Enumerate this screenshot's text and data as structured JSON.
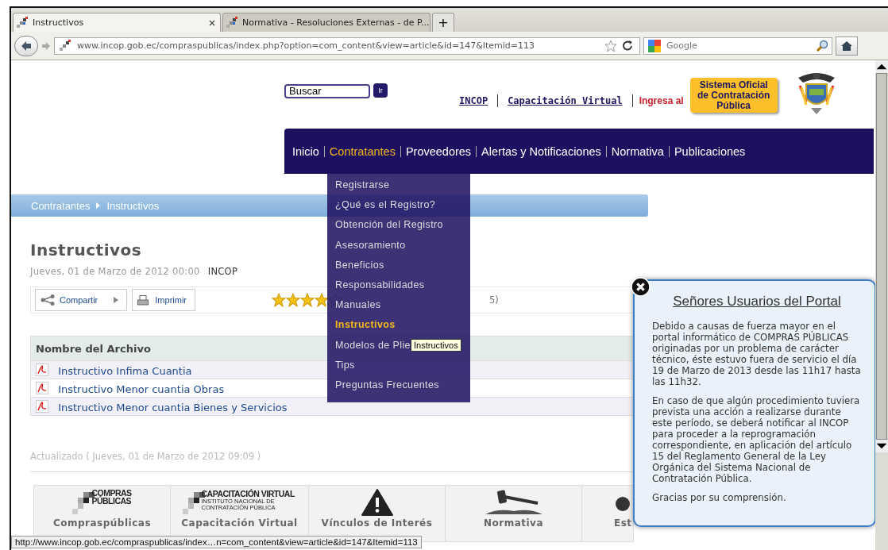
{
  "browser": {
    "tabs": [
      {
        "label": "Instructivos",
        "selected": true
      },
      {
        "label": "Normativa - Resoluciones Externas - de P...",
        "selected": false
      }
    ],
    "new_tab": "+",
    "address": "www.incop.gob.ec/compraspublicas/index.php?option=com_content&view=article&id=147&Itemid=113",
    "search_placeholder": "Google"
  },
  "header": {
    "search": {
      "value": "Buscar"
    },
    "search_button": "Ir",
    "links": [
      "INCOP",
      "Capacitación Virtual"
    ],
    "promo_label": "Ingresa al",
    "promo_button": "Sistema Oficial de Contratación Pública"
  },
  "nav": [
    {
      "label": "Inicio",
      "selected": false
    },
    {
      "label": "Contratantes",
      "selected": true
    },
    {
      "label": "Proveedores",
      "selected": false
    },
    {
      "label": "Alertas y Notificaciones",
      "selected": false
    },
    {
      "label": "Normativa",
      "selected": false
    },
    {
      "label": "Publicaciones",
      "selected": false
    }
  ],
  "dropdown": [
    {
      "label": "Registrarse",
      "selected": false
    },
    {
      "label": "¿Qué es el Registro?",
      "selected": false
    },
    {
      "label": "Obtención del Registro",
      "selected": false
    },
    {
      "label": "Asesoramiento",
      "selected": false
    },
    {
      "label": "Beneficios",
      "selected": false
    },
    {
      "label": "Responsabilidades",
      "selected": false
    },
    {
      "label": "Manuales",
      "selected": false
    },
    {
      "label": "Instructivos",
      "selected": true
    },
    {
      "label": "Modelos de Plie",
      "selected": false
    },
    {
      "label": "Tips",
      "selected": false
    },
    {
      "label": "Preguntas Frecuentes",
      "selected": false
    }
  ],
  "tooltip": "Instructivos",
  "breadcrumb": [
    "Contratantes",
    "Instructivos"
  ],
  "article": {
    "title": "Instructivos",
    "date": "Jueves, 01 de Marzo de 2012 00:00",
    "author": "INCOP",
    "share": "Compartir",
    "print": "Imprimir",
    "stars": 4,
    "rating_text": "5)",
    "table": {
      "columns": [
        "Nombre del Archivo"
      ],
      "rows": [
        "Instructivo Infima Cuantia",
        "Instructivo Menor cuantia Obras",
        "Instructivo Menor cuantia Bienes y Servicios"
      ]
    },
    "updated": "Actualizado ( Jueves, 01 de Marzo de 2012 09:09 )"
  },
  "footer_tiles": [
    {
      "kind": "compras",
      "logo_lines": [
        "COMPRAS",
        "PÚBLICAS"
      ],
      "label": "Compraspúblicas"
    },
    {
      "kind": "capacitacion",
      "logo_lines": [
        "CAPACITACIÓN VIRTUAL",
        "INSTITUTO NACIONAL DE CONTRATACIÓN PÚBLICA"
      ],
      "label": "Capacitación Virtual"
    },
    {
      "kind": "warning",
      "label": "Vínculos de Interés"
    },
    {
      "kind": "gavel",
      "label": "Normativa"
    },
    {
      "kind": "partial",
      "label": "Est"
    }
  ],
  "notice": {
    "title": "Señores Usuarios del Portal",
    "paragraphs": [
      "Debido a causas de fuerza mayor en el portal informático de COMPRAS PÚBLICAS originadas por un problema de carácter técnico, éste estuvo fuera de servicio el día 19 de Marzo de 2013 desde las 11h17 hasta las 11h32.",
      "En caso de que algún procedimiento tuviera prevista una acción a realizarse durante este período, se deberá notificar al INCOP para proceder a la reprogramación correspondiente, en aplicación del artículo 15 del Reglamento General de la Ley Orgánica del Sistema Nacional de Contratación Pública.",
      "Gracias por su comprensión."
    ]
  },
  "status_bar": "http://www.incop.gob.ec/compraspublicas/index…n=com_content&view=article&id=147&Itemid=113"
}
